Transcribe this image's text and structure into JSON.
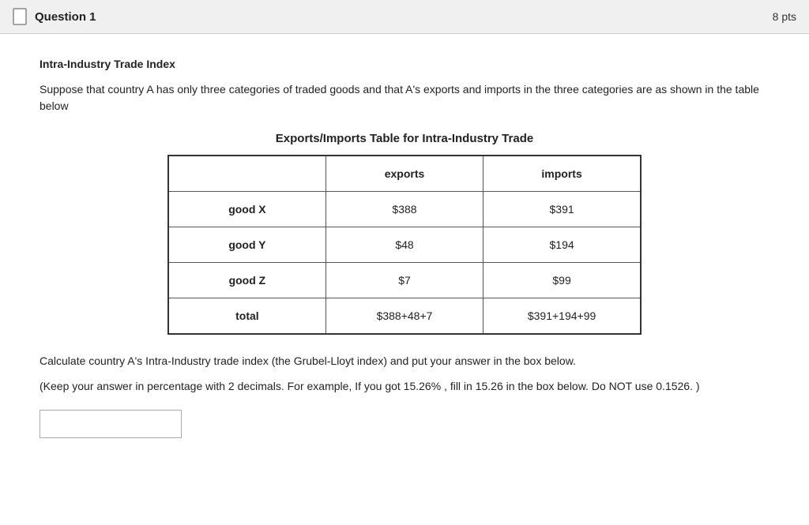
{
  "header": {
    "question_label": "Question 1",
    "points": "8 pts"
  },
  "section": {
    "title": "Intra-Industry Trade Index",
    "description": "Suppose that country A has only three categories of traded goods and that A's exports and imports in the three categories are as shown in the table below",
    "table_title": "Exports/Imports Table for Intra-Industry Trade",
    "table": {
      "col_headers": [
        "",
        "exports",
        "imports"
      ],
      "rows": [
        {
          "label": "good X",
          "exports": "$388",
          "imports": "$391"
        },
        {
          "label": "good Y",
          "exports": "$48",
          "imports": "$194"
        },
        {
          "label": "good Z",
          "exports": "$7",
          "imports": "$99"
        },
        {
          "label": "total",
          "exports": "$388+48+7",
          "imports": "$391+194+99"
        }
      ]
    },
    "instruction1": "Calculate country A's Intra-Industry trade index (the Grubel-Lloyt index) and put your answer in the box below.",
    "instruction2": "(Keep your answer in percentage with 2 decimals. For example, If you got 15.26% , fill in 15.26 in the box below. Do NOT use 0.1526. )"
  }
}
